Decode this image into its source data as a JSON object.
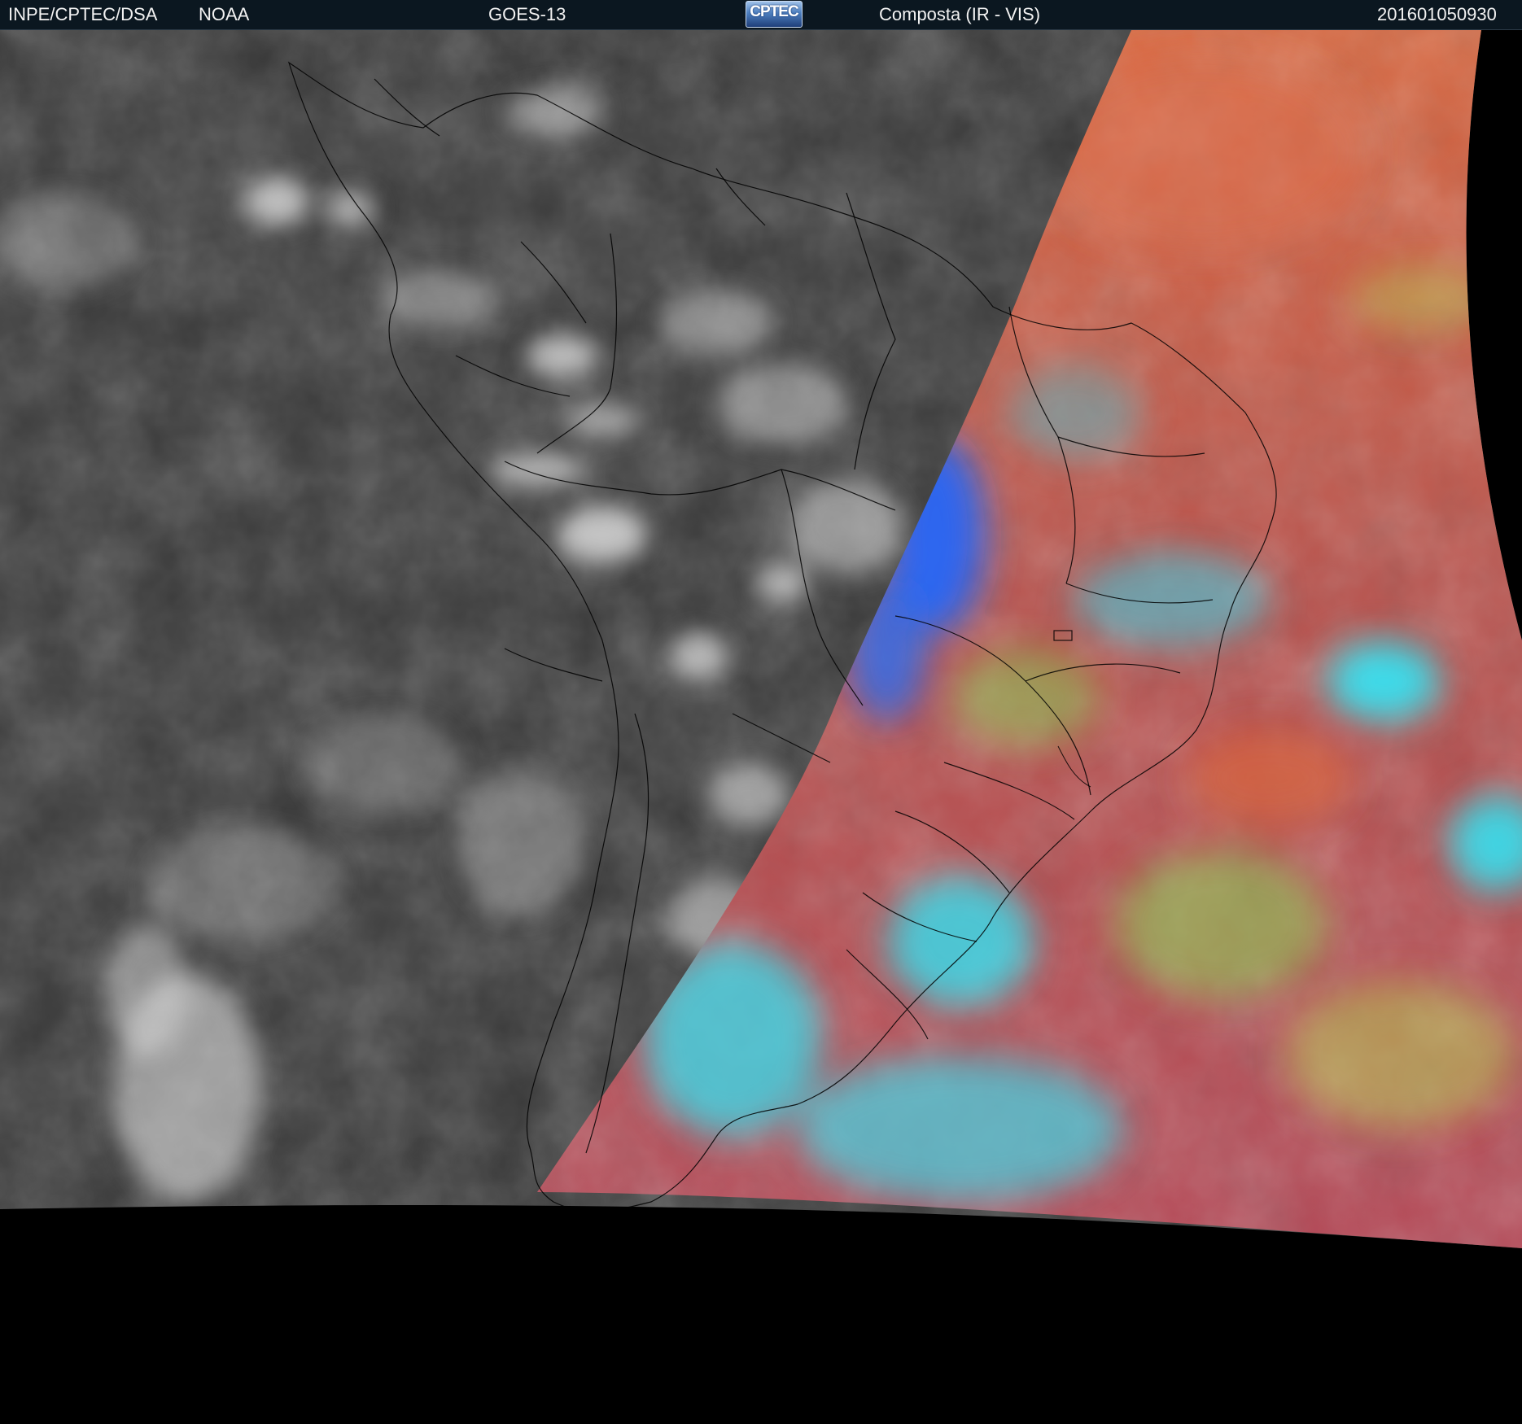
{
  "header": {
    "source": "INPE/CPTEC/DSA",
    "agency": "NOAA",
    "satellite": "GOES-13",
    "logo_text": "CPTEC",
    "product": "Composta (IR - VIS)",
    "timestamp": "201601050930"
  },
  "colors": {
    "header_bg": "#0b1720",
    "background": "#000000",
    "ir_gray": "#3a3a3a",
    "cloud_white": "#e8e8e8",
    "vis_red": "#b8504a",
    "vis_orange": "#d9673f",
    "vis_cyan": "#35e0f0",
    "vis_blue": "#1f66ff",
    "vis_green": "#8ad65a"
  }
}
